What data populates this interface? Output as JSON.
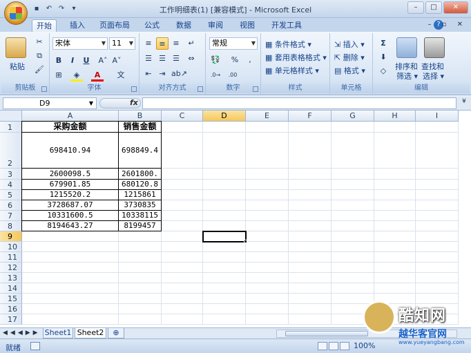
{
  "window": {
    "title": "工作明细表(1)  [兼容模式] - Microsoft Excel"
  },
  "tabs": [
    "开始",
    "插入",
    "页面布局",
    "公式",
    "数据",
    "审阅",
    "视图",
    "开发工具"
  ],
  "ribbon": {
    "clipboard": {
      "label": "剪贴板",
      "paste": "粘贴"
    },
    "font": {
      "label": "字体",
      "name": "宋体",
      "size": "11"
    },
    "alignment": {
      "label": "对齐方式"
    },
    "number": {
      "label": "数字",
      "format": "常规"
    },
    "styles": {
      "label": "样式",
      "cond": "条件格式",
      "table": "套用表格格式",
      "cell": "单元格样式"
    },
    "cells": {
      "label": "单元格",
      "insert": "插入",
      "delete": "删除",
      "format": "格式"
    },
    "editing": {
      "label": "编辑",
      "sort": "排序和",
      "sort2": "筛选",
      "find": "查找和",
      "find2": "选择"
    }
  },
  "formula_bar": {
    "name_box": "D9",
    "fx": "fx",
    "formula": ""
  },
  "columns": [
    "A",
    "B",
    "C",
    "D",
    "E",
    "F",
    "G",
    "H",
    "I"
  ],
  "rows": [
    "1",
    "2",
    "3",
    "4",
    "5",
    "6",
    "7",
    "8",
    "9",
    "10",
    "11",
    "12",
    "13",
    "14",
    "15",
    "16",
    "17"
  ],
  "cells": {
    "A1": "采购金额",
    "B1": "销售金额",
    "A2": "698410.94",
    "B2": "698849.4",
    "A3": "2600098.5",
    "B3": "2601800.",
    "A4": "679901.85",
    "B4": "680120.8",
    "A5": "1215520.2",
    "B5": "1215861",
    "A6": "3728687.07",
    "B6": "3730835",
    "A7": "10331600.5",
    "B7": "10338115",
    "A8": "8194643.27",
    "B8": "8199457"
  },
  "sheets": [
    "Sheet1",
    "Sheet2"
  ],
  "status": {
    "ready": "就绪",
    "zoom": "100%"
  },
  "watermark": {
    "name": "酷知网",
    "sub": "越华客官网",
    "url": "www.yueyangbang.com"
  }
}
